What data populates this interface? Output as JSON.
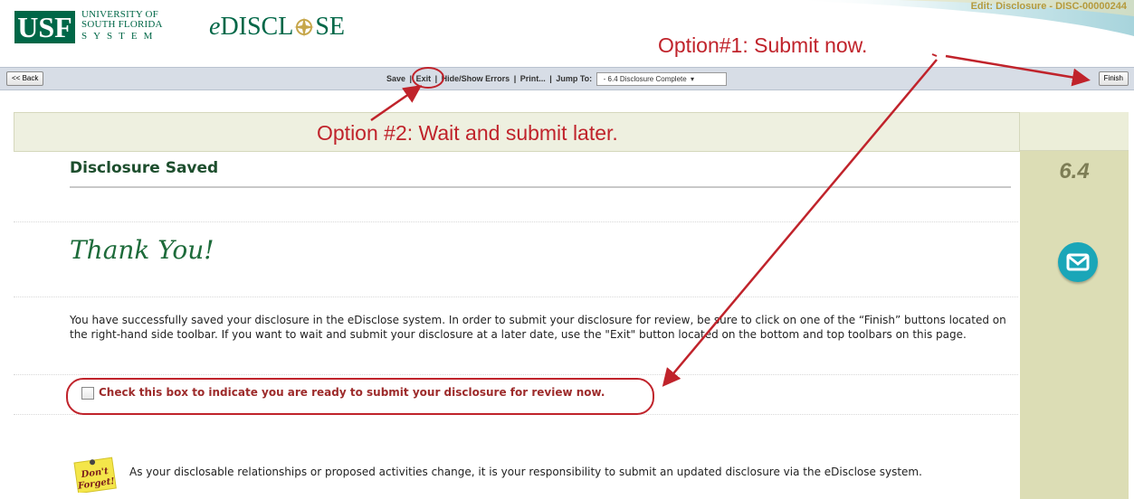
{
  "header": {
    "logo_text": "USF",
    "university_lines": [
      "UNIVERSITY OF",
      "SOUTH FLORIDA",
      "SYSTEM"
    ],
    "app_name_prefix": "e",
    "app_name_main": "DISCL",
    "app_name_suffix": "SE",
    "edit_title": "Edit: Disclosure - DISC-00000244"
  },
  "toolbar": {
    "back_label": "<< Back",
    "save_label": "Save",
    "exit_label": "Exit",
    "hide_show_errors_label": "Hide/Show Errors",
    "print_label": "Print...",
    "jump_to_label": "Jump To:",
    "jump_to_value": "- 6.4 Disclosure Complete",
    "finish_label": "Finish",
    "separator": "|"
  },
  "main": {
    "section_title": "Disclosure Saved",
    "thank_you": "Thank You!",
    "body_text": "You have successfully saved your disclosure in the eDisclose system. In order to submit your disclosure for review, be sure to click on one of the “Finish” buttons located on the right-hand side toolbar. If you want to wait and submit your disclosure at a later date, use the \"Exit\" button located on the bottom and top toolbars on this page.",
    "checkbox_label": "Check this box to indicate you are ready to submit your disclosure for review now.",
    "note_icon_text": [
      "Don't",
      "Forget!"
    ],
    "note_text": "As your disclosable relationships or proposed activities change, it is your responsibility to submit an updated disclosure via the eDisclose system."
  },
  "right_panel": {
    "step_number": "6.4",
    "icon": "mail-icon"
  },
  "annotations": {
    "option1": "Option#1: Submit now.",
    "option2": "Option #2: Wait and submit later.",
    "color": "#c0232b"
  },
  "colors": {
    "brand_green": "#006747",
    "toolbar_bg": "#d7dde6",
    "side_panel": "#dcddb5",
    "checkbox_text": "#9d2b2b",
    "mail_icon": "#1aa6b8"
  }
}
